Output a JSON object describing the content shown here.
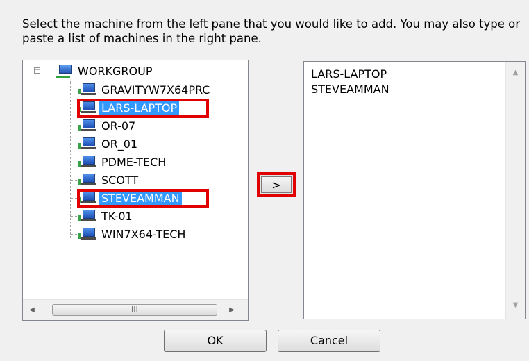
{
  "instruction": "Select the machine from the left pane that you would like to add.  You may also type or paste a list of machines in the right pane.",
  "tree": {
    "root_label": "WORKGROUP",
    "expander_symbol": "−",
    "items": [
      {
        "label": "GRAVITYW7X64PRC",
        "selected": false
      },
      {
        "label": "LARS-LAPTOP",
        "selected": true
      },
      {
        "label": "OR-07",
        "selected": false
      },
      {
        "label": "OR_01",
        "selected": false
      },
      {
        "label": "PDME-TECH",
        "selected": false
      },
      {
        "label": "SCOTT",
        "selected": false
      },
      {
        "label": "STEVEAMMAN",
        "selected": true
      },
      {
        "label": "TK-01",
        "selected": false
      },
      {
        "label": "WIN7X64-TECH",
        "selected": false
      }
    ],
    "scrollbar_thumb_grip": "III"
  },
  "move_button_label": ">",
  "list_pane": {
    "lines": [
      "LARS-LAPTOP",
      "STEVEAMMAN"
    ]
  },
  "buttons": {
    "ok_label": "OK",
    "cancel_label": "Cancel"
  },
  "colors": {
    "selection": "#3399ff",
    "highlight": "#e00000"
  }
}
